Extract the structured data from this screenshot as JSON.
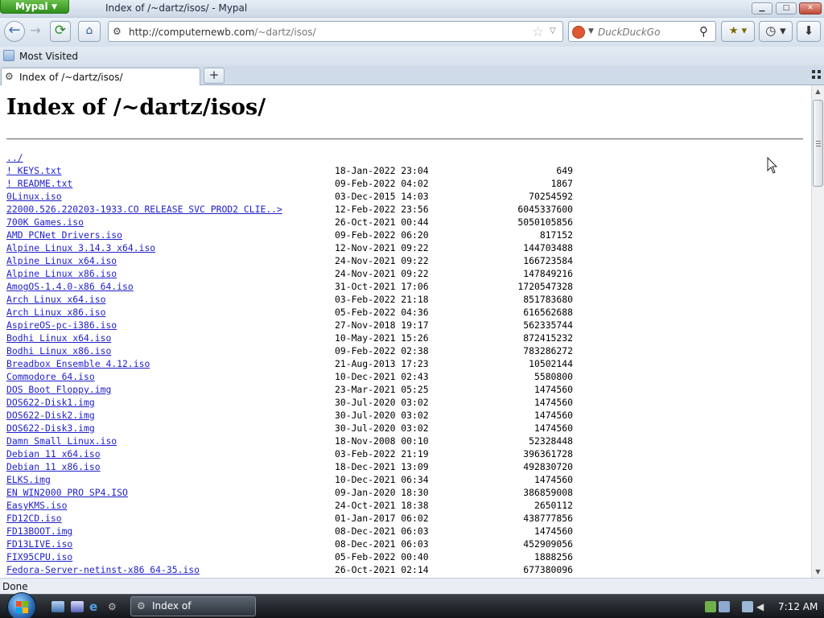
{
  "window": {
    "app_menu_label": "Mypal",
    "title": "Index of /~dartz/isos/ - Mypal",
    "minimize": "▁",
    "maximize": "□",
    "close": "✕"
  },
  "navbar": {
    "back": "←",
    "forward": "→",
    "reload": "⟳",
    "home": "⌂",
    "url_host": "http://computernewb.com",
    "url_path": "/~dartz/isos/",
    "bookmark_star": "☆",
    "url_dropdown": "▽",
    "search_placeholder": "DuckDuckGo",
    "search_go": "⚲",
    "bookmarks_btn": "★ ▾",
    "history_btn": "◷ ▾",
    "downloads_btn": "⬇"
  },
  "bookmarks_bar": {
    "items": [
      {
        "label": "Most Visited"
      }
    ]
  },
  "tabs": {
    "items": [
      {
        "label": "Index of /~dartz/isos/"
      }
    ],
    "new_tab": "+"
  },
  "page": {
    "title": "Index of /~dartz/isos/",
    "parent_link": "../",
    "files": [
      {
        "name": "! KEYS.txt",
        "date": "18-Jan-2022 23:04",
        "size": "649"
      },
      {
        "name": "! README.txt",
        "date": "09-Feb-2022 04:02",
        "size": "1867"
      },
      {
        "name": "0Linux.iso",
        "date": "03-Dec-2015 14:03",
        "size": "70254592"
      },
      {
        "name": "22000.526.220203-1933.CO RELEASE SVC PROD2 CLIE..>",
        "date": "12-Feb-2022 23:56",
        "size": "6045337600"
      },
      {
        "name": "700K Games.iso",
        "date": "26-Oct-2021 00:44",
        "size": "5050105856"
      },
      {
        "name": "AMD PCNet Drivers.iso",
        "date": "09-Feb-2022 06:20",
        "size": "817152"
      },
      {
        "name": "Alpine Linux 3.14.3 x64.iso",
        "date": "12-Nov-2021 09:22",
        "size": "144703488"
      },
      {
        "name": "Alpine Linux x64.iso",
        "date": "24-Nov-2021 09:22",
        "size": "166723584"
      },
      {
        "name": "Alpine Linux x86.iso",
        "date": "24-Nov-2021 09:22",
        "size": "147849216"
      },
      {
        "name": "AmogOS-1.4.0-x86 64.iso",
        "date": "31-Oct-2021 17:06",
        "size": "1720547328"
      },
      {
        "name": "Arch Linux x64.iso",
        "date": "03-Feb-2022 21:18",
        "size": "851783680"
      },
      {
        "name": "Arch Linux x86.iso",
        "date": "05-Feb-2022 04:36",
        "size": "616562688"
      },
      {
        "name": "AspireOS-pc-i386.iso",
        "date": "27-Nov-2018 19:17",
        "size": "562335744"
      },
      {
        "name": "Bodhi Linux x64.iso",
        "date": "10-May-2021 15:26",
        "size": "872415232"
      },
      {
        "name": "Bodhi Linux x86.iso",
        "date": "09-Feb-2022 02:38",
        "size": "783286272"
      },
      {
        "name": "Breadbox Ensemble 4.12.iso",
        "date": "21-Aug-2013 17:23",
        "size": "10502144"
      },
      {
        "name": "Commodore 64.iso",
        "date": "10-Dec-2021 02:43",
        "size": "5580800"
      },
      {
        "name": "DOS Boot Floppy.img",
        "date": "23-Mar-2021 05:25",
        "size": "1474560"
      },
      {
        "name": "DOS622-Disk1.img",
        "date": "30-Jul-2020 03:02",
        "size": "1474560"
      },
      {
        "name": "DOS622-Disk2.img",
        "date": "30-Jul-2020 03:02",
        "size": "1474560"
      },
      {
        "name": "DOS622-Disk3.img",
        "date": "30-Jul-2020 03:02",
        "size": "1474560"
      },
      {
        "name": "Damn Small Linux.iso",
        "date": "18-Nov-2008 00:10",
        "size": "52328448"
      },
      {
        "name": "Debian 11 x64.iso",
        "date": "03-Feb-2022 21:19",
        "size": "396361728"
      },
      {
        "name": "Debian 11 x86.iso",
        "date": "18-Dec-2021 13:09",
        "size": "492830720"
      },
      {
        "name": "ELKS.img",
        "date": "10-Dec-2021 06:34",
        "size": "1474560"
      },
      {
        "name": "EN WIN2000 PRO SP4.ISO",
        "date": "09-Jan-2020 18:30",
        "size": "386859008"
      },
      {
        "name": "EasyKMS.iso",
        "date": "24-Oct-2021 18:38",
        "size": "2650112"
      },
      {
        "name": "FD12CD.iso",
        "date": "01-Jan-2017 06:02",
        "size": "438777856"
      },
      {
        "name": "FD13BOOT.img",
        "date": "08-Dec-2021 06:03",
        "size": "1474560"
      },
      {
        "name": "FD13LIVE.iso",
        "date": "08-Dec-2021 06:03",
        "size": "452909056"
      },
      {
        "name": "FIX95CPU.iso",
        "date": "05-Feb-2022 00:40",
        "size": "1888256"
      },
      {
        "name": "Fedora-Server-netinst-x86 64-35.iso",
        "date": "26-Oct-2021 02:14",
        "size": "677380096"
      }
    ]
  },
  "status": {
    "text": "Done"
  },
  "taskbar": {
    "window_button_label": "Index of /~dartz/iso...",
    "clock": "7:12 AM"
  }
}
